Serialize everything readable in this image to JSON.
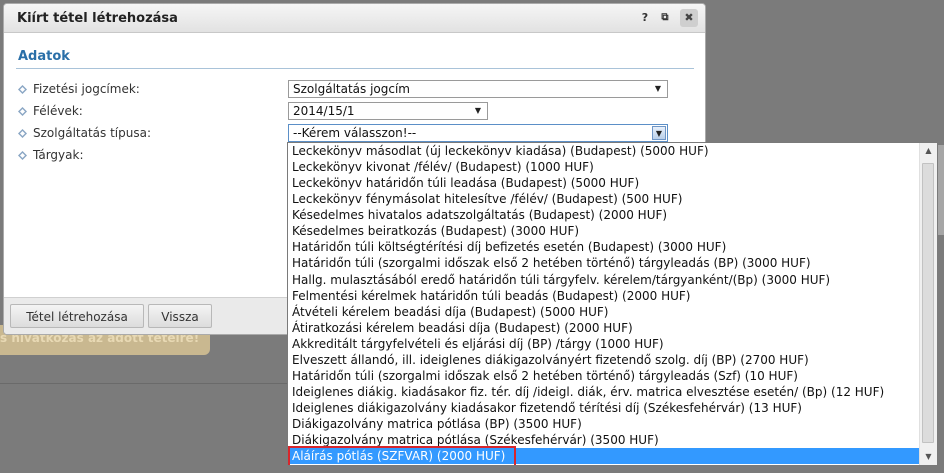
{
  "dialog": {
    "title": "Kiírt tétel létrehozása",
    "help_icon": "?",
    "popout_icon": "⧉",
    "close_icon": "✖"
  },
  "section": {
    "header": "Adatok"
  },
  "form": {
    "rows": [
      {
        "label": "Fizetési jogcímek:",
        "value": "Szolgáltatás jogcím"
      },
      {
        "label": "Félévek:",
        "value": "2014/15/1"
      },
      {
        "label": "Szolgáltatás típusa:",
        "value": "--Kérem válasszon!--"
      },
      {
        "label": "Tárgyak:"
      }
    ]
  },
  "buttons": {
    "create": "Tétel létrehozása",
    "back": "Vissza"
  },
  "background": {
    "warning_text": "s hivatkozás az adott tételre!"
  },
  "dropdown": {
    "items": [
      "Leckekönyv másodlat (új leckekönyv kiadása) (Budapest) (5000 HUF)",
      "Leckekönyv kivonat /félév/ (Budapest) (1000 HUF)",
      "Leckekönyv határidőn túli leadása (Budapest) (5000 HUF)",
      "Leckekönyv fénymásolat hitelesítve /félév/ (Budapest) (500 HUF)",
      "Késedelmes hivatalos adatszolgáltatás (Budapest) (2000 HUF)",
      "Késedelmes beiratkozás (Budapest) (3000 HUF)",
      "Határidőn túli költségtérítési díj befizetés esetén (Budapest) (3000 HUF)",
      "Határidőn túli (szorgalmi időszak első 2 hetében történő) tárgyleadás (BP) (3000 HUF)",
      "Hallg. mulasztásából eredő határidőn túli tárgyfelv. kérelem/tárgyanként/(Bp) (3000 HUF)",
      "Felmentési kérelmek határidőn túli beadás (Budapest) (2000 HUF)",
      "Átvételi kérelem beadási díja (Budapest) (5000 HUF)",
      "Átiratkozási kérelem beadási díja (Budapest) (2000 HUF)",
      "Akkreditált tárgyfelvételi és eljárási díj (BP) /tárgy (1000 HUF)",
      "Elveszett állandó, ill. ideiglenes diákigazolványért fizetendő szolg. díj (BP) (2700 HUF)",
      "Határidőn túli (szorgalmi időszak első 2 hetében történő) tárgyleadás (Szf) (10 HUF)",
      "Ideiglenes diákig. kiadásakor fiz. tér. díj /ideigl. diák, érv. matrica elvesztése esetén/ (Bp) (12 HUF)",
      "Ideiglenes diákigazolvány kiadásakor fizetendő térítési díj (Székesfehérvár) (13 HUF)",
      "Diákigazolvány matrica pótlása (BP) (3500 HUF)",
      "Diákigazolvány matrica pótlása (Székesfehérvár) (3500 HUF)",
      "Aláírás pótlás (SZFVAR) (2000 HUF)"
    ],
    "selected_index": 19
  },
  "colors": {
    "accent": "#2a6fa8",
    "selection": "#3399ff",
    "highlight": "#d8262c"
  },
  "icons": {
    "row_bullet": "diamond-bullet-icon",
    "arrow": "▼",
    "scroll_up": "▲",
    "scroll_down": "▼"
  }
}
